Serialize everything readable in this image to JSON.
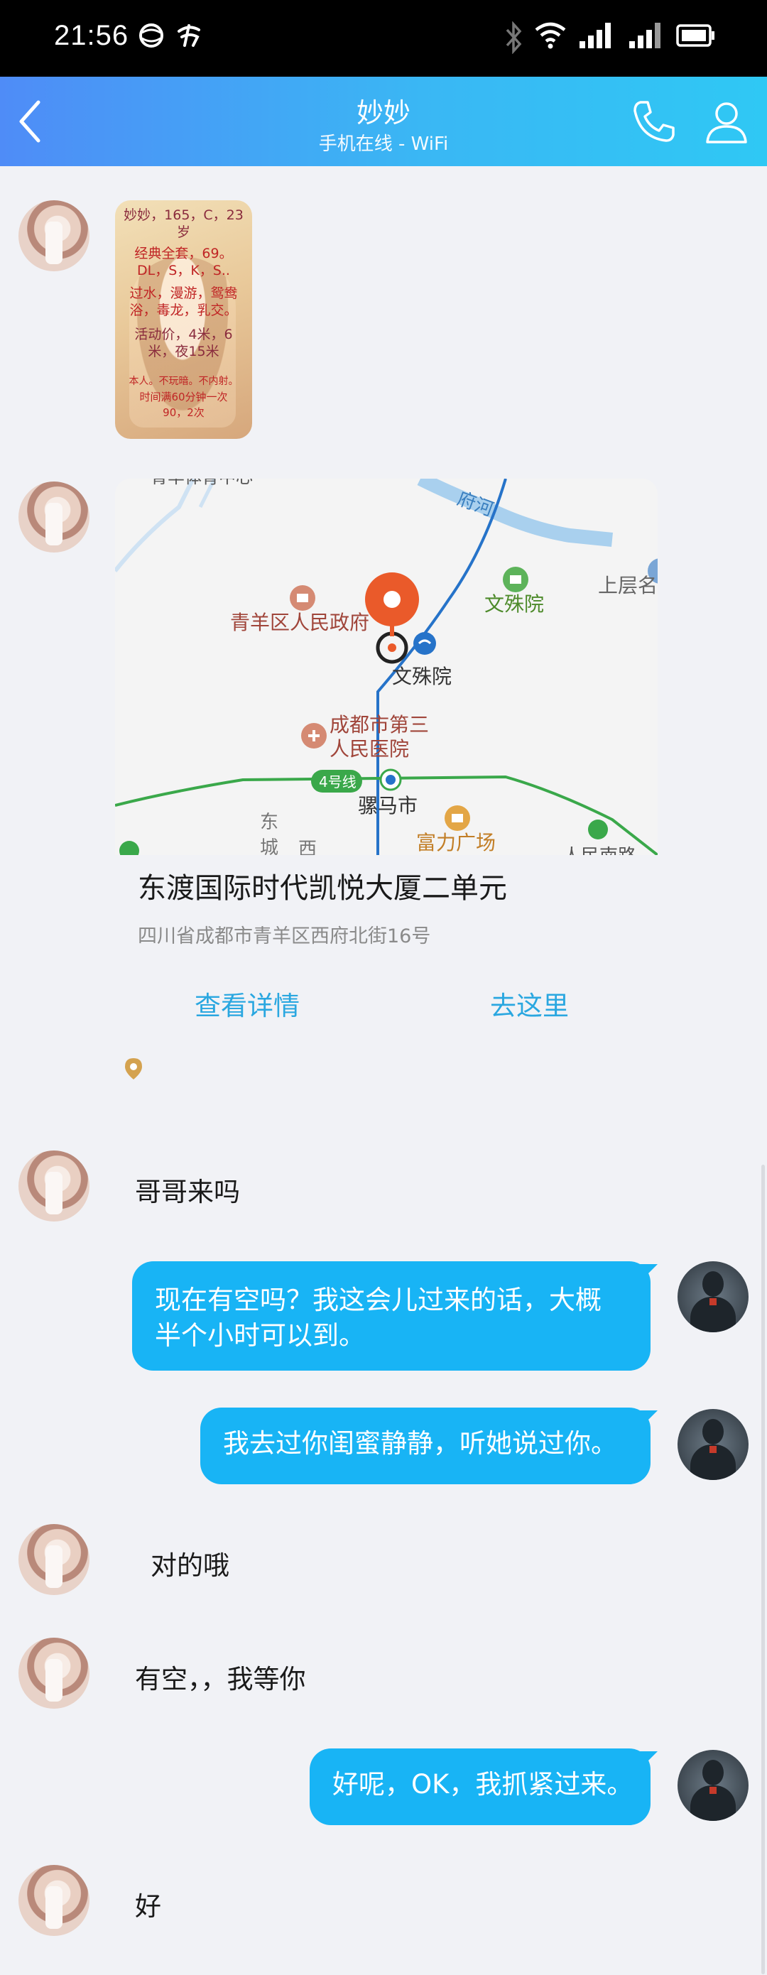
{
  "status_bar": {
    "time": "21:56"
  },
  "header": {
    "title": "妙妙",
    "subtitle": "手机在线 - WiFi"
  },
  "poster": {
    "lines": [
      "妙妙，165，C，23",
      "岁",
      "经典全套，69。",
      "DL，S，K，S..",
      "过水，漫游，鸳鸯",
      "浴，毒龙，乳交。",
      "活动价，4米，6",
      "米，夜15米",
      "本人。不玩暗。不内射。",
      "时间满60分钟一次",
      "90，2次"
    ]
  },
  "map": {
    "labels": {
      "river_partial": "府河",
      "top_left_partial": "青羊体育中心",
      "gov": "青羊区人民政府",
      "temple_top": "文殊院",
      "temple_station": "文殊院",
      "upper_right": "上层名人",
      "hospital_line1": "成都市第三",
      "hospital_line2": "人民医院",
      "line4": "4号线",
      "luomashi": "骡马市",
      "fuli": "富力广场",
      "dong": "东",
      "cheng": "城",
      "west_partial": "西",
      "bottom_right_partial": "人民南路"
    },
    "location_name": "东渡国际时代凯悦大厦二单元",
    "location_address": "四川省成都市青羊区西府北街16号",
    "details_label": "查看详情",
    "navigate_label": "去这里"
  },
  "messages": [
    {
      "side": "her",
      "text": "哥哥来吗"
    },
    {
      "side": "me",
      "line1": "现在有空吗？我这会儿过来的话，大概",
      "line2": "半个小时可以到。"
    },
    {
      "side": "me",
      "text": "我去过你闺蜜静静，听她说过你。"
    },
    {
      "side": "her",
      "text": "对的哦"
    },
    {
      "side": "her",
      "text": "有空，，我等你"
    },
    {
      "side": "me",
      "text": "好呢，OK，我抓紧过来。"
    },
    {
      "side": "her",
      "text": "好"
    }
  ],
  "colors": {
    "header_gradient_start": "#4f8cf7",
    "header_gradient_end": "#2fc8f4",
    "bubble": "#18b4f5",
    "link": "#2aa7e0",
    "background": "#f1f2f6"
  }
}
